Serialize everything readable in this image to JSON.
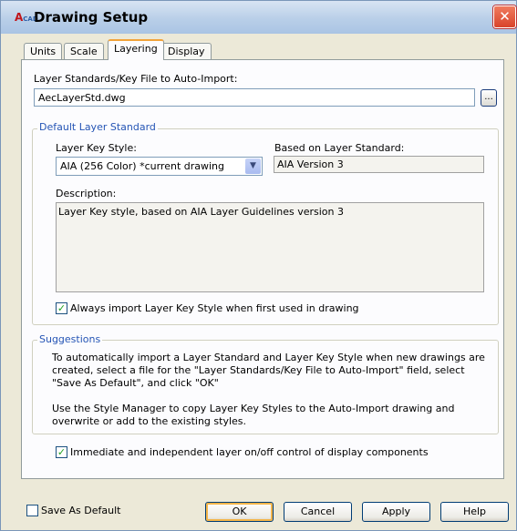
{
  "window": {
    "title": "Drawing Setup",
    "app_icon_text": "A",
    "app_icon_sub": "CAD"
  },
  "tabs": [
    {
      "label": "Units"
    },
    {
      "label": "Scale"
    },
    {
      "label": "Layering"
    },
    {
      "label": "Display"
    }
  ],
  "layering": {
    "auto_import_label": "Layer Standards/Key File to Auto-Import:",
    "auto_import_value": "AecLayerStd.dwg",
    "browse_label": "...",
    "default_group_label": "Default Layer Standard",
    "key_style_label": "Layer Key Style:",
    "key_style_value": "AIA (256 Color) *current drawing",
    "based_on_label": "Based on Layer Standard:",
    "based_on_value": "AIA Version 3",
    "description_label": "Description:",
    "description_value": "Layer Key style, based on AIA Layer Guidelines version 3",
    "always_import_label": "Always import Layer Key Style when first used in drawing",
    "always_import_checked": true,
    "suggestions_label": "Suggestions",
    "suggestion_1": "To automatically import a Layer Standard and Layer Key Style when new drawings are created, select a file for the \"Layer Standards/Key File to Auto-Import\" field, select \"Save As Default\", and click \"OK\"",
    "suggestion_2": "Use the Style Manager to copy Layer Key Styles to the Auto-Import drawing and overwrite or add to the existing styles.",
    "immediate_label": "Immediate and independent layer on/off control of display components",
    "immediate_checked": true
  },
  "footer": {
    "save_default_label": "Save As Default",
    "save_default_checked": false,
    "ok_label": "OK",
    "cancel_label": "Cancel",
    "apply_label": "Apply",
    "help_label": "Help"
  }
}
